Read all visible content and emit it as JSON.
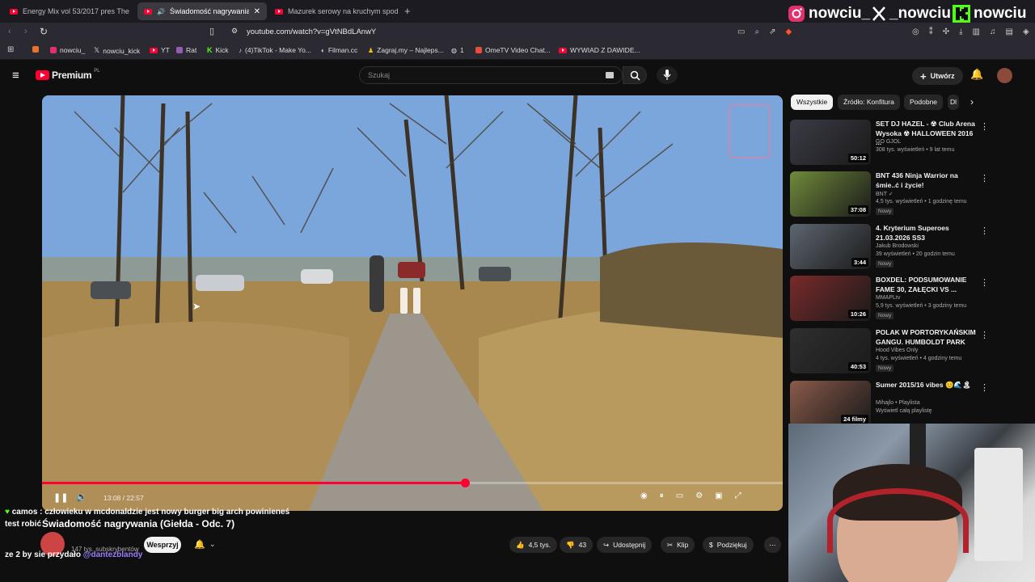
{
  "browser": {
    "tabs": [
      {
        "label": "Energy Mix vol 53/2017 pres The",
        "active": false
      },
      {
        "label": "Świadomość nagrywania (Gie",
        "active": true
      },
      {
        "label": "Mazurek serowy na kruchym spodzie",
        "active": false
      }
    ],
    "url": "youtube.com/watch?v=gVtNBdLAnwY",
    "bookmarks": [
      {
        "label": "nowciu_",
        "color": "#e1306c"
      },
      {
        "label": "nowciu_kick",
        "color": "#ffffff"
      },
      {
        "label": "YT",
        "color": "#ff0033"
      },
      {
        "label": "Rat",
        "color": "#9b59b6"
      },
      {
        "label": "Kick",
        "color": "#53fc18"
      },
      {
        "label": "(4)TikTok - Make Yo...",
        "color": "#ffffff"
      },
      {
        "label": "Filman.cc",
        "color": "#ffffff"
      },
      {
        "label": "Zagraj.my – Najleps...",
        "color": "#f1c40f"
      },
      {
        "label": "1",
        "color": "#aaaaaa"
      },
      {
        "label": "OmeTV Video Chat...",
        "color": "#e74c3c"
      },
      {
        "label": "WYWIAD Z DAWIDE...",
        "color": "#ff0033"
      }
    ]
  },
  "overlay": {
    "socials": [
      {
        "name": "nowciu_",
        "icon": "instagram-icon",
        "color": "#e1306c"
      },
      {
        "name": "_nowciu",
        "icon": "x-icon",
        "color": "#ffffff"
      },
      {
        "name": "nowciu",
        "icon": "kick-icon",
        "color": "#53fc18"
      }
    ]
  },
  "youtube": {
    "logo": "Premium",
    "logo_region": "PL",
    "search_placeholder": "Szukaj",
    "create_label": "Utwórz"
  },
  "player": {
    "current_time": "13:08",
    "duration": "22:57",
    "progress_fraction": 0.571
  },
  "video": {
    "title": "Świadomość nagrywania (Giełda - Odc. 7)",
    "channel_subs": "147 tys. subskrybentów",
    "support_label": "Wesprzyj",
    "likes": "4,5 tys.",
    "dislikes": "43",
    "share_label": "Udostępnij",
    "clip_label": "Klip",
    "thanks_label": "Podziękuj"
  },
  "chat": {
    "line1": "camos : człowieku w mcdonaldzie jest nowy burger big arch powinieneś",
    "line2_prefix": "test robić",
    "line3": "ze 2 by sie przydało",
    "line3_mention": "@dantezblandy"
  },
  "sidebar": {
    "chips": [
      {
        "label": "Wszystkie",
        "active": true
      },
      {
        "label": "Źródło: Konfitura",
        "active": false
      },
      {
        "label": "Podobne",
        "active": false
      },
      {
        "label": "Dl",
        "active": false
      }
    ],
    "recommendations": [
      {
        "title": "SET DJ HAZEL - ☢ Club Arena Wysoka ☢ HALLOWEEN 2016 ...",
        "channel": "GO GJOL",
        "meta": "308 tys. wyświetleń • 9 lat temu",
        "duration": "50:12",
        "badge": "",
        "thumb": "#3b3b46"
      },
      {
        "title": "BNT 436 Ninja Warrior na śmie..ć i życie!",
        "channel": "BNT ✓",
        "meta": "4,5 tys. wyświetleń • 1 godzinę temu",
        "duration": "37:08",
        "badge": "Nowy",
        "thumb": "#6f8a3a"
      },
      {
        "title": "4. Kryterium Superoes 21.03.2026 SS3",
        "channel": "Jakub Brodowski",
        "meta": "39 wyświetleń • 20 godzin temu",
        "duration": "3:44",
        "badge": "Nowy",
        "thumb": "#5d6670"
      },
      {
        "title": "BOXDEL: PODSUMOWANIE FAME 30, ZAŁĘCKI VS ...",
        "channel": "MMAPLtv",
        "meta": "5,9 tys. wyświetleń • 3 godziny temu",
        "duration": "10:26",
        "badge": "Nowy",
        "thumb": "#7a2a2a"
      },
      {
        "title": "POLAK W PORTORYKAŃSKIM GANGU. HUMBOLDT PARK",
        "channel": "Hood Vibes Only",
        "meta": "4 tys. wyświetleń • 4 godziny temu",
        "duration": "40:53",
        "badge": "Nowy",
        "thumb": "#2f2f2f"
      },
      {
        "title": "Sumer 2015/16 vibes 😊🌊🏝",
        "channel": "Mihajlo • Playlista",
        "meta": "Wyświetl całą playlistę",
        "duration": "24 filmy",
        "badge": "",
        "thumb": "#8a5a4a"
      }
    ]
  }
}
